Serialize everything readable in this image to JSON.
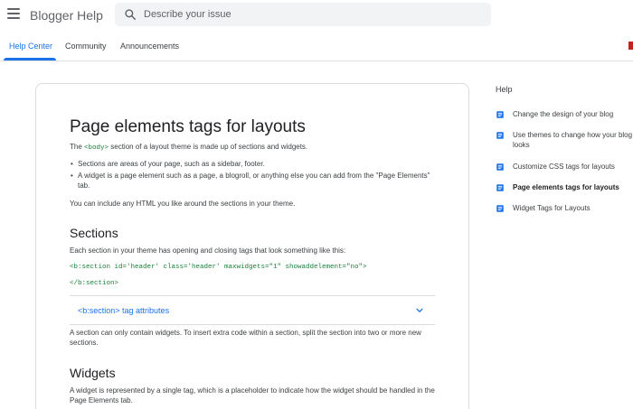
{
  "header": {
    "app_title": "Blogger Help",
    "search_placeholder": "Describe your issue"
  },
  "tabs": [
    {
      "label": "Help Center",
      "active": true
    },
    {
      "label": "Community",
      "active": false
    },
    {
      "label": "Announcements",
      "active": false
    }
  ],
  "article": {
    "title": "Page elements tags for layouts",
    "intro_prefix": "The ",
    "intro_code": "<body>",
    "intro_suffix": " section of a layout theme is made up of sections and widgets.",
    "bullets": [
      "Sections are areas of your page, such as a sidebar, footer.",
      "A widget is a page element such as a page, a blogroll, or anything else you can add from the \"Page Elements\" tab."
    ],
    "html_note": "You can include any HTML you like around the sections in your theme.",
    "sections_heading": "Sections",
    "sections_text": "Each section in your theme has opening and  closing tags that look something like this:",
    "code_open": "<b:section id='header' class='header' maxwidgets=\"1\" showaddelement=\"no\">",
    "code_close": "</b:section>",
    "accordion_label": "<b:section> tag attributes",
    "section_note": "A section can only contain widgets. To insert extra code within a section, split the section into two or more new sections.",
    "widgets_heading": "Widgets",
    "widgets_text": "A widget is represented by a single tag, which is a placeholder to indicate how the widget should be handled in the Page Elements tab."
  },
  "sidebar": {
    "title": "Help",
    "items": [
      {
        "label": "Change the design of your blog",
        "active": false
      },
      {
        "label": "Use themes to change how your blog looks",
        "active": false
      },
      {
        "label": "Customize CSS tags for layouts",
        "active": false
      },
      {
        "label": "Page elements tags for layouts",
        "active": true
      },
      {
        "label": "Widget Tags for Layouts",
        "active": false
      }
    ]
  },
  "colors": {
    "accent": "#1a73e8",
    "code_green": "#188038",
    "icon_grey": "#5f6368"
  }
}
